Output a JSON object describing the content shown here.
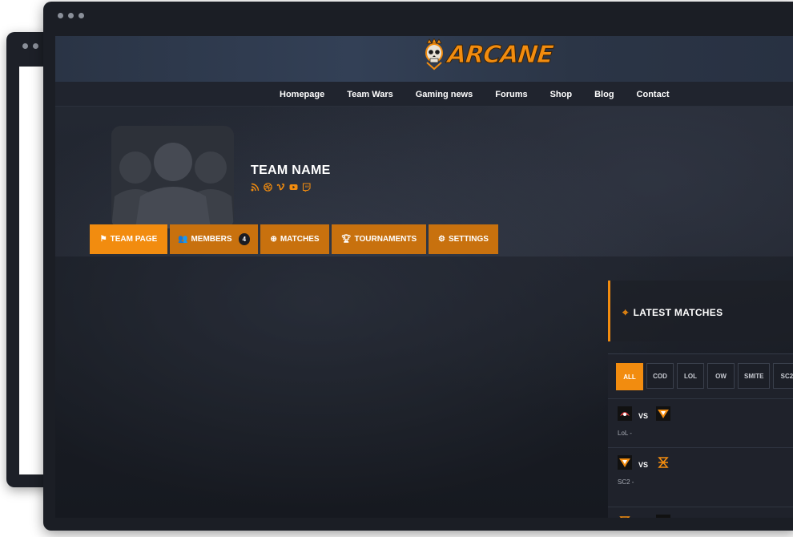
{
  "site": {
    "logo_text": "ARCANE",
    "nav": [
      "Homepage",
      "Team Wars",
      "Gaming news",
      "Forums",
      "Shop",
      "Blog",
      "Contact"
    ]
  },
  "team": {
    "name": "TEAM NAME",
    "socials": [
      "rss-icon",
      "dribbble-icon",
      "vimeo-icon",
      "youtube-icon",
      "twitch-icon"
    ]
  },
  "tabs": {
    "team_page": "TEAM PAGE",
    "members": "MEMBERS",
    "members_count": "4",
    "matches": "MATCHES",
    "tournaments": "TOURNAMENTS",
    "settings": "SETTINGS"
  },
  "latest_matches": {
    "title": "LATEST MATCHES",
    "filters": [
      "ALL",
      "COD",
      "LOL",
      "OW",
      "SMITE",
      "SC2"
    ],
    "matches": [
      {
        "vs": "VS",
        "game": "LoL -"
      },
      {
        "vs": "VS",
        "game": "SC2 -"
      }
    ]
  },
  "colors": {
    "accent": "#f28c0f",
    "tab": "#c8710e",
    "background": "#1b1e25"
  }
}
